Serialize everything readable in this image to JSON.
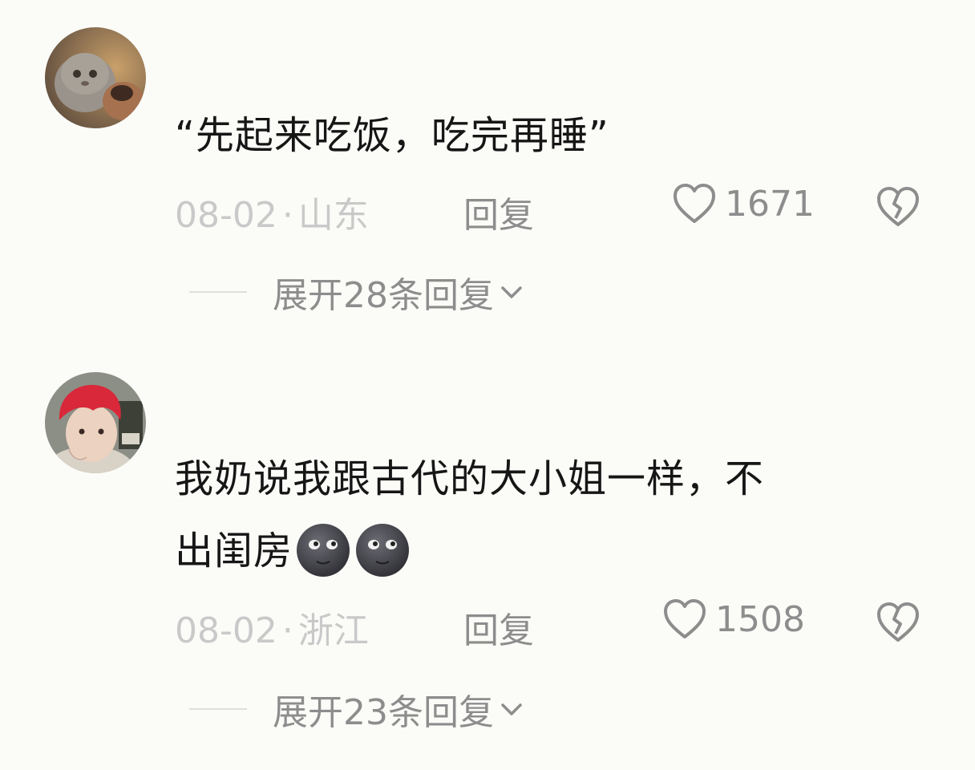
{
  "comments": [
    {
      "text_line1": "“先起来吃饭，吃完再睡”",
      "text_line2": "",
      "date": "08-02",
      "separator": "·",
      "location": "山东",
      "reply_label": "回复",
      "likes": "1671",
      "expand_label": "展开28条回复",
      "avatar_icon": "cat-avatar",
      "reactions": []
    },
    {
      "text_line1": "我奶说我跟古代的大小姐一样，不",
      "text_line2": "出闺房",
      "date": "08-02",
      "separator": "·",
      "location": "浙江",
      "reply_label": "回复",
      "likes": "1508",
      "expand_label": "展开23条回复",
      "avatar_icon": "red-hair-person-avatar",
      "reactions": [
        "new-moon-face-emoji",
        "new-moon-face-emoji"
      ]
    }
  ],
  "colors": {
    "background": "#fbfbf8",
    "text_primary": "#161616",
    "text_muted": "#8d8d8d",
    "text_light": "#c9c9c9"
  }
}
